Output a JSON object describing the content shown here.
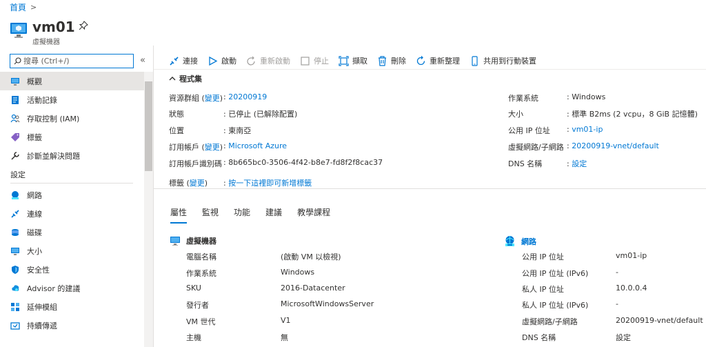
{
  "breadcrumb": {
    "home": "首頁"
  },
  "header": {
    "title": "vm01",
    "subtitle": "虛擬機器"
  },
  "search": {
    "placeholder": "搜尋 (Ctrl+/)"
  },
  "sidebar": {
    "items": [
      {
        "label": "概觀",
        "icon": "monitor-icon",
        "active": true
      },
      {
        "label": "活動記錄",
        "icon": "activity-log-icon"
      },
      {
        "label": "存取控制 (IAM)",
        "icon": "people-icon"
      },
      {
        "label": "標籤",
        "icon": "tag-icon"
      },
      {
        "label": "診斷並解決問題",
        "icon": "wrench-icon"
      }
    ],
    "settings_header": "設定",
    "settings_items": [
      {
        "label": "網路",
        "icon": "network-icon"
      },
      {
        "label": "連線",
        "icon": "connect-icon"
      },
      {
        "label": "磁碟",
        "icon": "disk-icon"
      },
      {
        "label": "大小",
        "icon": "size-icon"
      },
      {
        "label": "安全性",
        "icon": "shield-icon"
      },
      {
        "label": "Advisor 的建議",
        "icon": "advisor-icon"
      },
      {
        "label": "延伸模組",
        "icon": "extensions-icon"
      },
      {
        "label": "持續傳遞",
        "icon": "continuous-delivery-icon"
      }
    ]
  },
  "toolbar": {
    "connect": "連接",
    "start": "啟動",
    "restart": "重新啟動",
    "stop": "停止",
    "capture": "擷取",
    "delete": "刪除",
    "refresh": "重新整理",
    "share": "共用到行動裝置"
  },
  "essentials": {
    "header": "程式集",
    "change": "變更",
    "left": [
      {
        "key": "資源群組",
        "change": true,
        "value": "20200919",
        "link": true
      },
      {
        "key": "狀態",
        "value": "已停止 (已解除配置)"
      },
      {
        "key": "位置",
        "value": "東南亞"
      },
      {
        "key": "訂用帳戶",
        "change": true,
        "value": "Microsoft Azure",
        "link": true
      },
      {
        "key": "訂用帳戶識別碼",
        "value": "8b665bc0-3506-4f42-b8e7-fd8f2f8cac37"
      }
    ],
    "right": [
      {
        "key": "作業系統",
        "value": "Windows"
      },
      {
        "key": "大小",
        "value": "標準 B2ms (2 vcpu，8 GiB 記憶體)"
      },
      {
        "key": "公用 IP 位址",
        "value": "vm01-ip",
        "link": true
      },
      {
        "key": "虛擬網路/子網路",
        "value": "20200919-vnet/default",
        "link": true
      },
      {
        "key": "DNS 名稱",
        "value": "設定",
        "link": true
      }
    ],
    "tags": {
      "key": "標籤",
      "change": "變更",
      "value": "按一下這裡即可新增標籤"
    }
  },
  "tabs": [
    "屬性",
    "監視",
    "功能",
    "建議",
    "教學課程"
  ],
  "vm_section": {
    "title": "虛擬機器",
    "rows": [
      {
        "key": "電腦名稱",
        "value": "(啟動 VM 以檢視)"
      },
      {
        "key": "作業系統",
        "value": "Windows"
      },
      {
        "key": "SKU",
        "value": "2016-Datacenter"
      },
      {
        "key": "發行者",
        "value": "MicrosoftWindowsServer"
      },
      {
        "key": "VM 世代",
        "value": "V1"
      },
      {
        "key": "主機",
        "value": "無",
        "link": true
      }
    ]
  },
  "network_section": {
    "title": "網路",
    "rows": [
      {
        "key": "公用 IP 位址",
        "value": "vm01-ip",
        "link": true
      },
      {
        "key": "公用 IP 位址 (IPv6)",
        "value": "-"
      },
      {
        "key": "私人 IP 位址",
        "value": "10.0.0.4"
      },
      {
        "key": "私人 IP 位址 (IPv6)",
        "value": "-"
      },
      {
        "key": "虛擬網路/子網路",
        "value": "20200919-vnet/default",
        "link": true
      },
      {
        "key": "DNS 名稱",
        "value": "設定",
        "link": true
      }
    ]
  },
  "colors": {
    "accent": "#0078d4",
    "text": "#323130",
    "muted": "#605e5c",
    "active_bg": "#e7e5e3"
  }
}
